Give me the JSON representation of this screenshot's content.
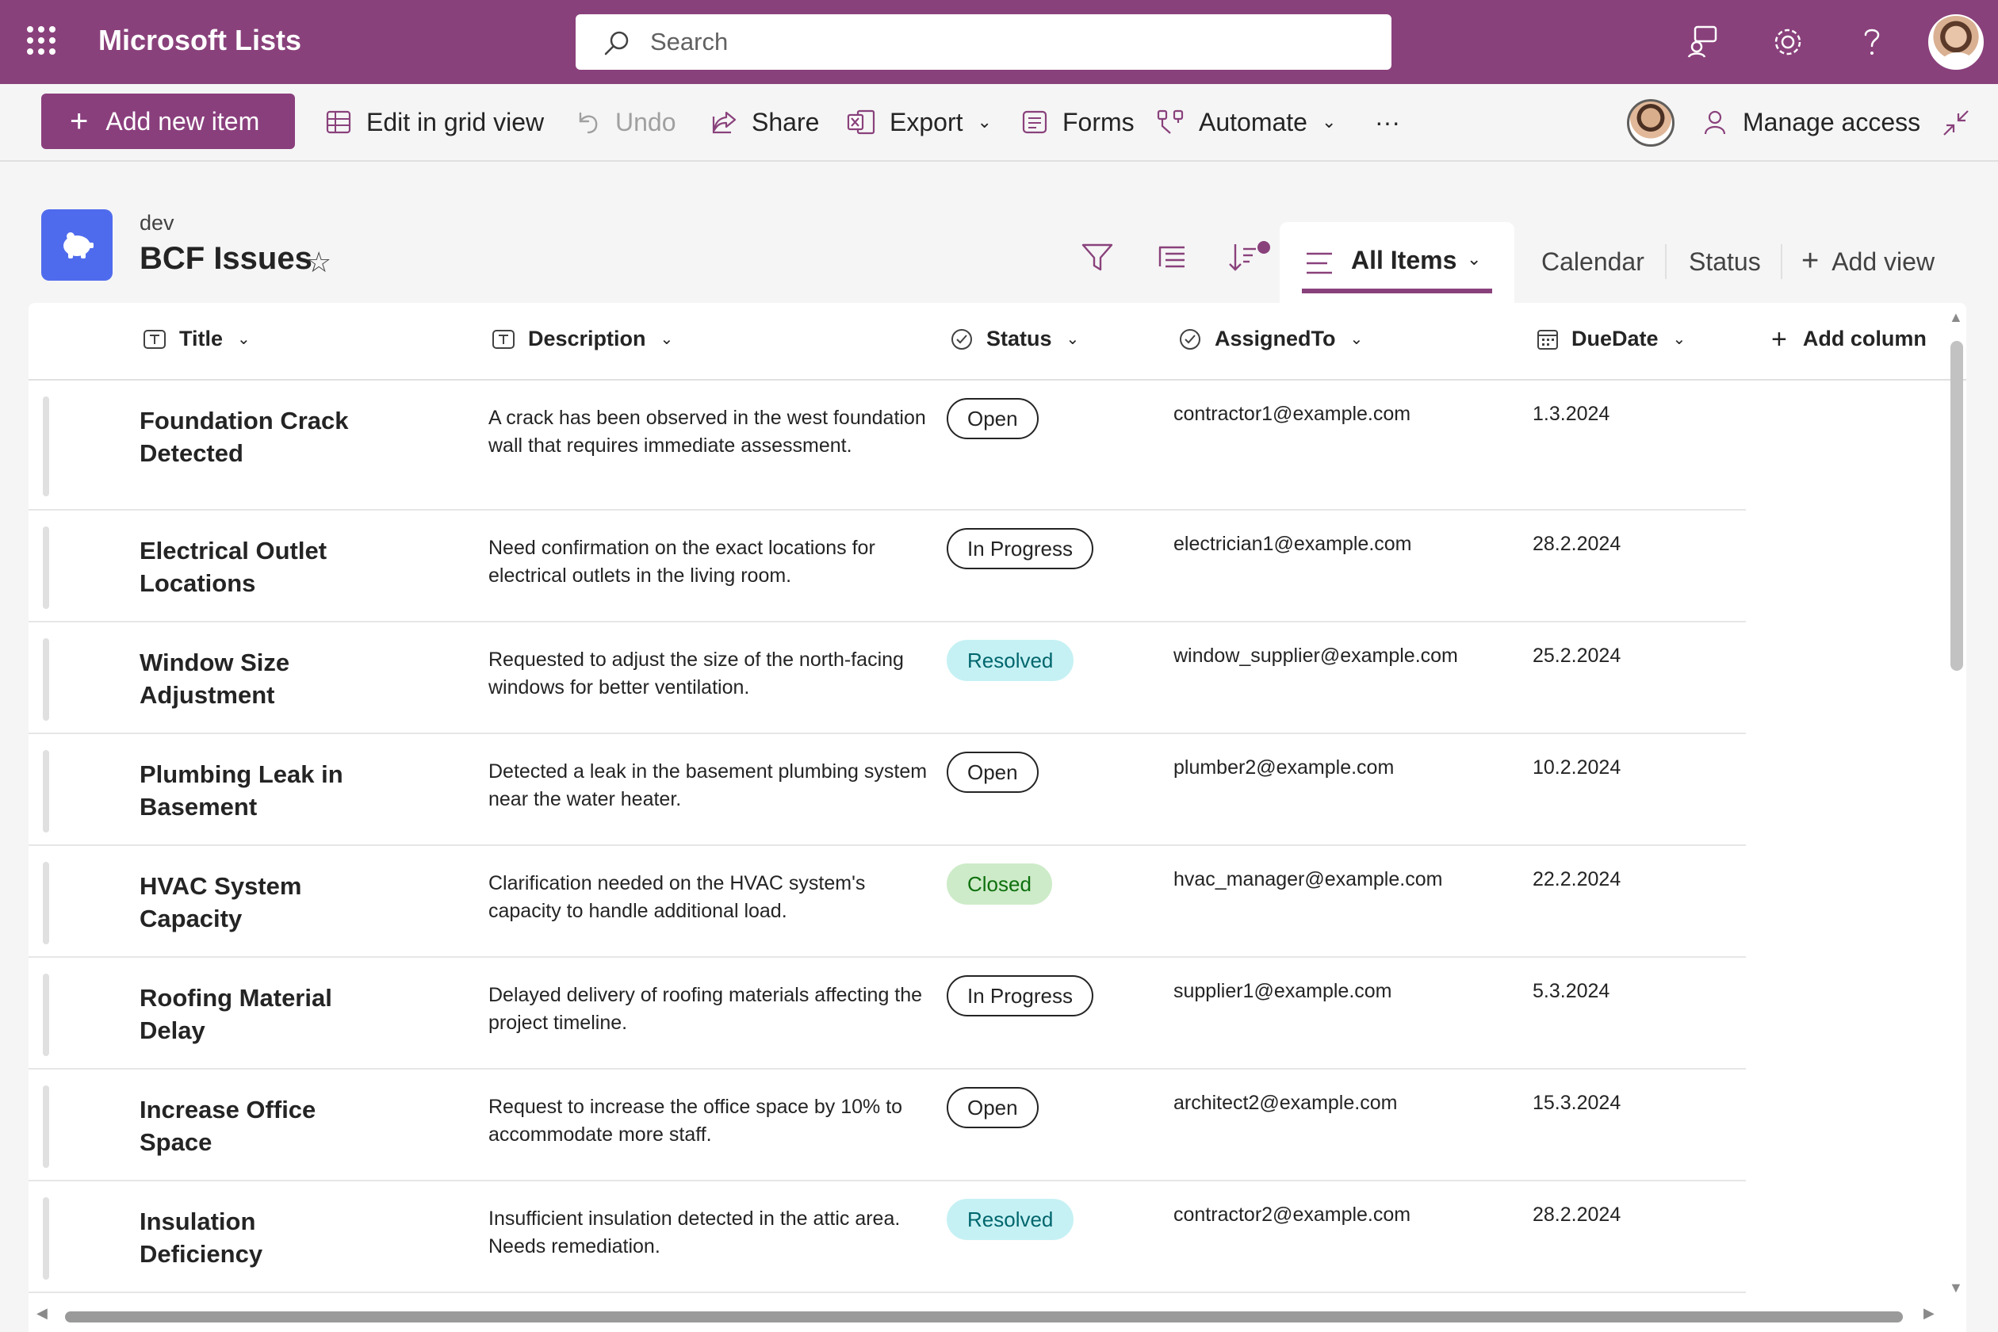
{
  "app": {
    "title": "Microsoft Lists"
  },
  "search": {
    "placeholder": "Search"
  },
  "commands": {
    "add_new_item": "Add new item",
    "edit_grid": "Edit in grid view",
    "undo": "Undo",
    "share": "Share",
    "export": "Export",
    "forms": "Forms",
    "automate": "Automate",
    "more": "···",
    "manage_access": "Manage access"
  },
  "list": {
    "site": "dev",
    "title": "BCF Issues"
  },
  "views": {
    "active": "All Items",
    "calendar": "Calendar",
    "status": "Status",
    "add_view": "Add view"
  },
  "columns": {
    "title": "Title",
    "description": "Description",
    "status": "Status",
    "assigned": "AssignedTo",
    "due": "DueDate",
    "add_column": "Add column"
  },
  "rows": [
    {
      "title": "Foundation Crack Detected",
      "description": "A crack has been observed in the west foundation wall that requires immediate assessment.",
      "status": "Open",
      "assigned": "contractor1@example.com",
      "due": "1.3.2024"
    },
    {
      "title": "Electrical Outlet Locations",
      "description": "Need confirmation on the exact locations for electrical outlets in the living room.",
      "status": "In Progress",
      "assigned": "electrician1@example.com",
      "due": "28.2.2024"
    },
    {
      "title": "Window Size Adjustment",
      "description": "Requested to adjust the size of the north-facing windows for better ventilation.",
      "status": "Resolved",
      "assigned": "window_supplier@example.com",
      "due": "25.2.2024"
    },
    {
      "title": "Plumbing Leak in Basement",
      "description": "Detected a leak in the basement plumbing system near the water heater.",
      "status": "Open",
      "assigned": "plumber2@example.com",
      "due": "10.2.2024"
    },
    {
      "title": "HVAC System Capacity",
      "description": "Clarification needed on the HVAC system's capacity to handle additional load.",
      "status": "Closed",
      "assigned": "hvac_manager@example.com",
      "due": "22.2.2024"
    },
    {
      "title": "Roofing Material Delay",
      "description": "Delayed delivery of roofing materials affecting the project timeline.",
      "status": "In Progress",
      "assigned": "supplier1@example.com",
      "due": "5.3.2024"
    },
    {
      "title": "Increase Office Space",
      "description": "Request to increase the office space by 10% to accommodate more staff.",
      "status": "Open",
      "assigned": "architect2@example.com",
      "due": "15.3.2024"
    },
    {
      "title": "Insulation Deficiency",
      "description": "Insufficient insulation detected in the attic area. Needs remediation.",
      "status": "Resolved",
      "assigned": "contractor2@example.com",
      "due": "28.2.2024"
    }
  ],
  "colors": {
    "brand": "#89417b",
    "primary_button": "#8a3f7d",
    "list_icon": "#4f6bed"
  },
  "icons": [
    "waffle-icon",
    "search-icon",
    "feedback-icon",
    "gear-icon",
    "help-icon",
    "plus-icon",
    "grid-icon",
    "undo-icon",
    "share-icon",
    "excel-icon",
    "forms-icon",
    "automate-icon",
    "person-icon",
    "collapse-icon",
    "filter-icon",
    "group-icon",
    "sort-icon",
    "list-view-icon",
    "star-icon",
    "text-column-icon",
    "choice-column-icon",
    "calendar-column-icon"
  ]
}
